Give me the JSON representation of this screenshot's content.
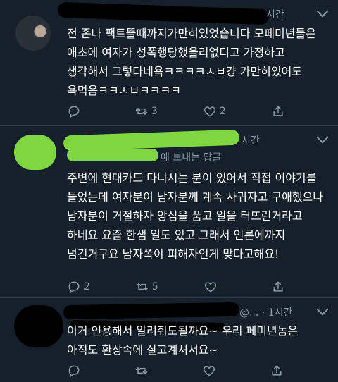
{
  "tweets": [
    {
      "time": "시간",
      "text": "전 존나 팩트뜰때까지가만히있었습니다 모페미년들은 애초에 여자가 성폭행당했을리없디고 가정하고 생각해서 그렇다네욬ㅋㅋㅋㅋㅅㅂ걍 가만히있어도 욕먹음ㅋㅋㅅㅂㅋㅋㅋㅋ",
      "actions": {
        "reply": "",
        "retweet": "3",
        "like": "2",
        "share": ""
      }
    },
    {
      "time": "시간",
      "reply_label": "에 보내는 답글",
      "text": "주변에 현대카드 다니시는 분이 있어서 직접 이야기를 들었는데 여자분이 남자분께 계속 사귀자고 구애했으나 남자분이 거절하자 앙심을 품고 일을 터뜨린거라고 하네요 요즘 한샘 일도 있고 그래서 언론에까지 넘긴거구요 남자쪽이 피해자인게 맞다고해요!",
      "actions": {
        "reply": "2",
        "retweet": "5",
        "like": "",
        "share": ""
      }
    },
    {
      "time": "@... · 1시간",
      "text": "이거 인용해서 알려줘도될까요~ 우리 페미년놈은 아직도 환상속에 살고계셔서요~",
      "actions": {
        "reply": "",
        "retweet": "",
        "like": "",
        "share": ""
      }
    }
  ],
  "colors": {
    "background": "#15202b",
    "text": "#ffffff",
    "muted": "#8899a6",
    "scribble_green": "#7fd640"
  },
  "icons": [
    "reply-icon",
    "retweet-icon",
    "like-icon",
    "share-icon",
    "caret-down-icon"
  ]
}
